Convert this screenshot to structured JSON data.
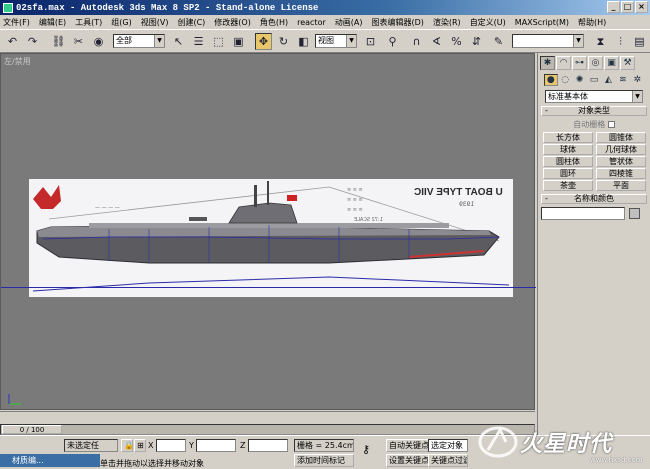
{
  "window": {
    "title": "02sfa.max - Autodesk 3ds Max 8 SP2 - Stand-alone License",
    "controls": [
      "_",
      "□",
      "×"
    ]
  },
  "menu": [
    "文件(F)",
    "编辑(E)",
    "工具(T)",
    "组(G)",
    "视图(V)",
    "创建(C)",
    "修改器(O)",
    "角色(H)",
    "reactor",
    "动画(A)",
    "图表编辑器(D)",
    "渲染(R)",
    "自定义(U)",
    "MAXScript(M)",
    "帮助(H)"
  ],
  "toolbar": {
    "selection_filter": "全部",
    "ref_coord": "视图",
    "named_selection": ""
  },
  "viewport": {
    "label": "左/禁用",
    "blueprint": {
      "heading": "U BOAT TYPE VIIC",
      "subheading": "1939",
      "small_text": "1:72 SCALE"
    }
  },
  "command_panel": {
    "category": "标准基本体",
    "rollouts": {
      "object_type": "对象类型",
      "autogrid": "自动栅格",
      "name_color": "名称和颜色"
    },
    "buttons": [
      "长方体",
      "圆锥体",
      "球体",
      "几何球体",
      "圆柱体",
      "管状体",
      "圆环",
      "四棱锥",
      "茶壶",
      "平面"
    ],
    "expand_symbol": "-"
  },
  "timeslider": {
    "frame": "0 / 100"
  },
  "status": {
    "selection": "未选定任",
    "x_label": "X",
    "y_label": "Y",
    "z_label": "Z",
    "grid": "栅格 = 25.4cm",
    "auto_key": "自动关键点",
    "set_key": "设置关键点",
    "selected_object": "选定对象",
    "key_filters": "关键点过滤器",
    "prompt": "单击并拖动以选择并移动对象",
    "add_time_tag": "添加时间标记"
  },
  "taskbar": {
    "item": "材质编..."
  },
  "watermark": {
    "text": "火星时代",
    "url": "www.hxsd.com"
  },
  "colors": {
    "titlebar": "#0a246a",
    "viewport_bg": "#7a7a7a",
    "active_tool": "#e8c66a"
  }
}
